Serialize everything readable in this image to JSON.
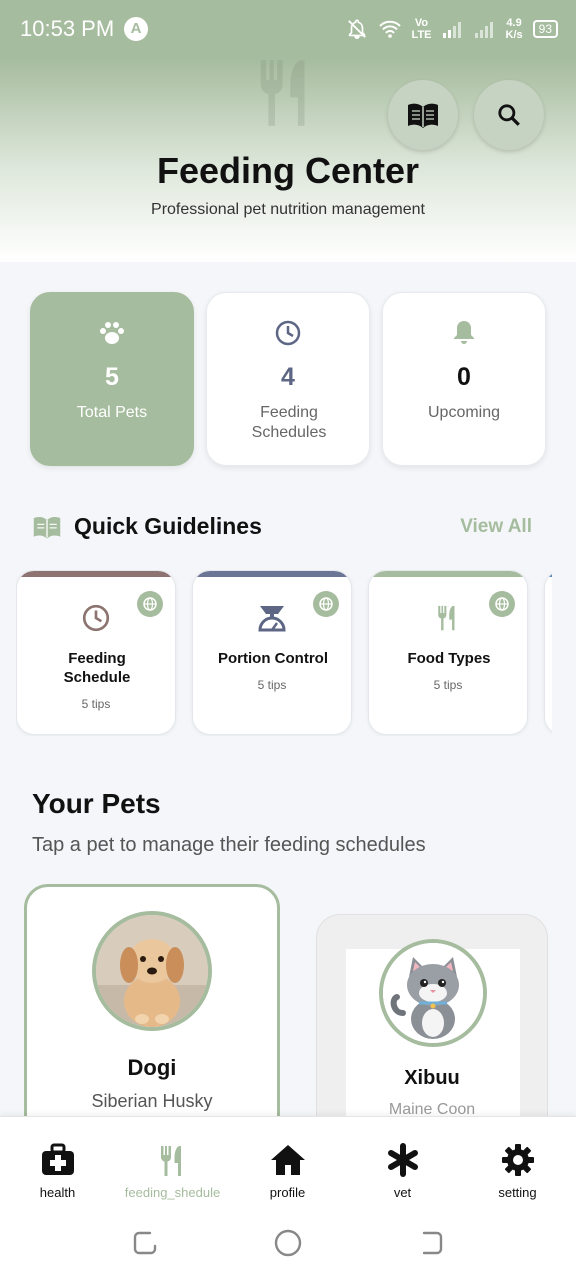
{
  "status_bar": {
    "time": "10:53 PM",
    "net_speed_value": "4.9",
    "net_speed_unit": "K/s",
    "network_type_top": "Vo",
    "network_type_bottom": "LTE",
    "battery": "93"
  },
  "header": {
    "title": "Feeding Center",
    "subtitle": "Professional pet nutrition management"
  },
  "stats": [
    {
      "value": "5",
      "label": "Total Pets",
      "icon": "paw-icon"
    },
    {
      "value": "4",
      "label": "Feeding Schedules",
      "icon": "clock-icon"
    },
    {
      "value": "0",
      "label": "Upcoming",
      "icon": "bell-icon"
    }
  ],
  "guidelines": {
    "title": "Quick Guidelines",
    "view_all": "View All",
    "items": [
      {
        "name": "Feeding Schedule",
        "tips": "5 tips",
        "icon": "clock-icon",
        "accent": "#8d7470"
      },
      {
        "name": "Portion Control",
        "tips": "5 tips",
        "icon": "scale-icon",
        "accent": "#6b7595"
      },
      {
        "name": "Food Types",
        "tips": "5 tips",
        "icon": "utensils-icon",
        "accent": "#a6bc9e"
      }
    ]
  },
  "pets": {
    "title": "Your Pets",
    "subtitle": "Tap a pet to manage their feeding schedules",
    "items": [
      {
        "name": "Dogi",
        "breed": "Siberian Husky"
      },
      {
        "name": "Xibuu",
        "breed": "Maine Coon"
      }
    ]
  },
  "nav": [
    {
      "label": "health",
      "icon": "medical-kit-icon"
    },
    {
      "label": "feeding_shedule",
      "icon": "utensils-icon"
    },
    {
      "label": "profile",
      "icon": "home-icon"
    },
    {
      "label": "vet",
      "icon": "asterisk-icon"
    },
    {
      "label": "setting",
      "icon": "gear-icon"
    }
  ],
  "colors": {
    "accent": "#a6bc9e",
    "background": "#f4f6f9",
    "text": "#111111"
  }
}
